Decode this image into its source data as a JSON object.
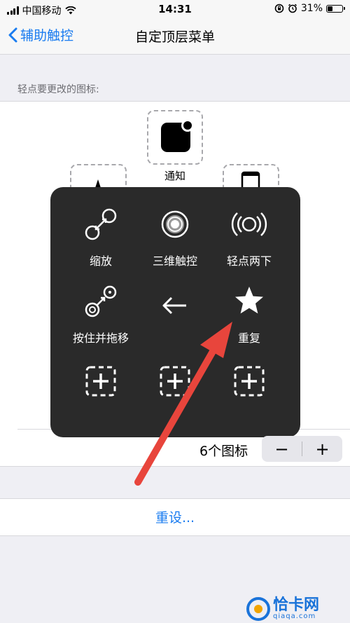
{
  "status_bar": {
    "carrier": "中国移动",
    "time": "14:31",
    "battery_percent": "31%",
    "battery_level": 0.31
  },
  "nav": {
    "back_label": "辅助触控",
    "title": "自定顶层菜单"
  },
  "section_label": "轻点要更改的图标:",
  "top_slot": {
    "label": "通知",
    "icon": "notification-icon"
  },
  "menu_items": [
    {
      "label": "缩放",
      "icon": "zoom-icon"
    },
    {
      "label": "三维触控",
      "icon": "3d-touch-icon"
    },
    {
      "label": "轻点两下",
      "icon": "double-tap-icon"
    },
    {
      "label": "按住并拖移",
      "icon": "hold-drag-icon"
    },
    {
      "label": "",
      "icon": "back-arrow-icon"
    },
    {
      "label": "重复",
      "icon": "star-icon"
    },
    {
      "label": "",
      "icon": "add-icon"
    },
    {
      "label": "",
      "icon": "add-icon"
    },
    {
      "label": "",
      "icon": "add-icon"
    }
  ],
  "icon_count_label": "6个图标",
  "stepper": {
    "minus": "−",
    "plus": "+"
  },
  "reset_label": "重设...",
  "watermark": {
    "title": "恰卡网",
    "subtitle": "qiaqa.com"
  },
  "colors": {
    "accent": "#1a7cf0",
    "popup_bg": "#2a2a2a",
    "arrow": "#e8453c"
  }
}
